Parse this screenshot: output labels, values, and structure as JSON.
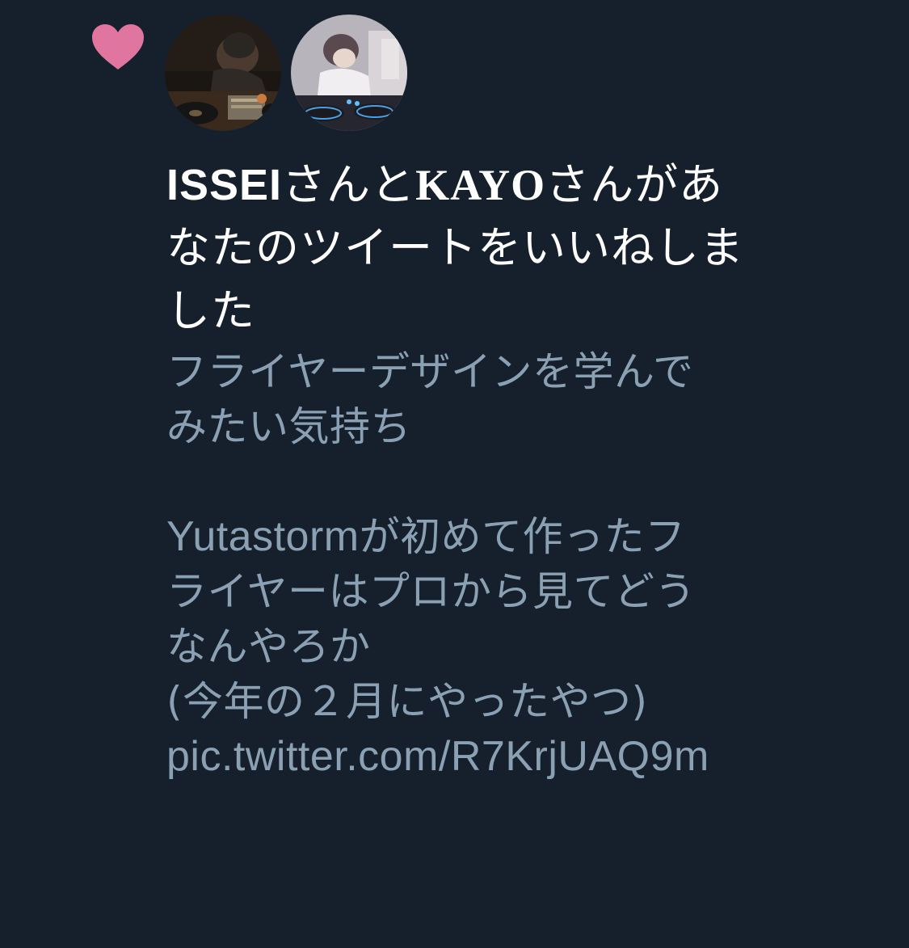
{
  "notification": {
    "type_icon": "heart-icon",
    "icon_color": "#e0759f",
    "avatars": [
      {
        "name": "ISSEI",
        "icon": "avatar-dj-icon"
      },
      {
        "name": "KAYO",
        "icon": "avatar-dj-icon"
      }
    ],
    "headline": {
      "user1": "ISSEI",
      "joiner1": "さんと",
      "user2": "KAYO",
      "joiner2": "さんがあ",
      "line2": "なたのツイートをいいねしま",
      "line3": "した"
    },
    "tweet": {
      "line1": "フライヤーデザインを学んで",
      "line2": "みたい気持ち",
      "line4_latin": "Yutastorm",
      "line4_rest": "が初めて作ったフ",
      "line5": "ライヤーはプロから見てどう",
      "line6": "なんやろか",
      "line7": "(今年の２月にやったやつ)",
      "line8": "pic.twitter.com/R7KrjUAQ9m"
    }
  },
  "colors": {
    "background": "#16202c",
    "headline_text": "#ffffff",
    "tweet_text": "#8ba1b3",
    "heart": "#e0759f"
  }
}
